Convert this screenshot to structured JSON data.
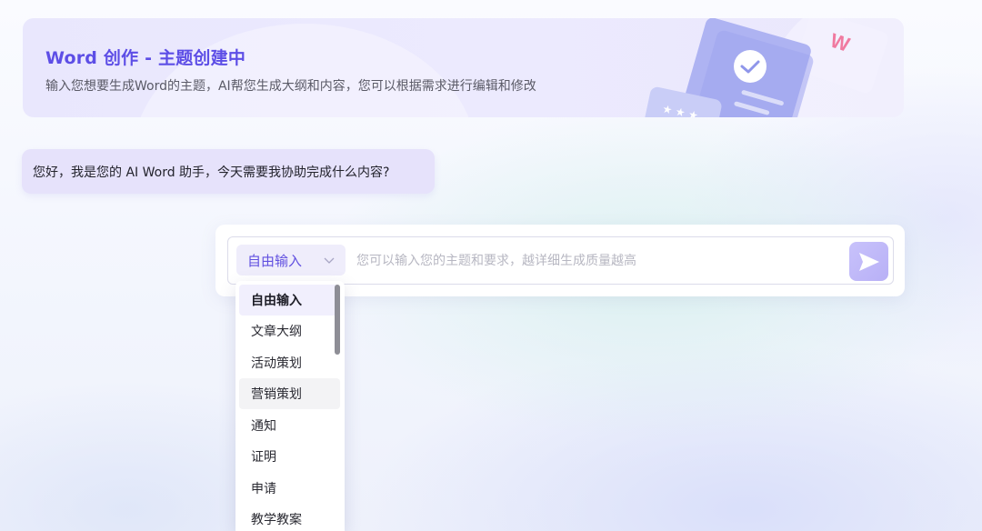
{
  "banner": {
    "title": "Word 创作 - 主题创建中",
    "subtitle": "输入您想要生成Word的主题，AI帮您生成大纲和内容，您可以根据需求进行编辑和修改",
    "accent_color": "#5d4ee6"
  },
  "greeting": {
    "text": "您好，我是您的 AI Word 助手，今天需要我协助完成什么内容?"
  },
  "composer": {
    "mode_selected": "自由输入",
    "placeholder": "您可以输入您的主题和要求，越详细生成质量越高",
    "value": "",
    "send_icon": "send-icon"
  },
  "dropdown": {
    "items": [
      {
        "label": "自由输入",
        "state": "selected"
      },
      {
        "label": "文章大纲",
        "state": ""
      },
      {
        "label": "活动策划",
        "state": ""
      },
      {
        "label": "营销策划",
        "state": "hovered"
      },
      {
        "label": "通知",
        "state": ""
      },
      {
        "label": "证明",
        "state": ""
      },
      {
        "label": "申请",
        "state": ""
      },
      {
        "label": "教学教案",
        "state": ""
      }
    ]
  }
}
